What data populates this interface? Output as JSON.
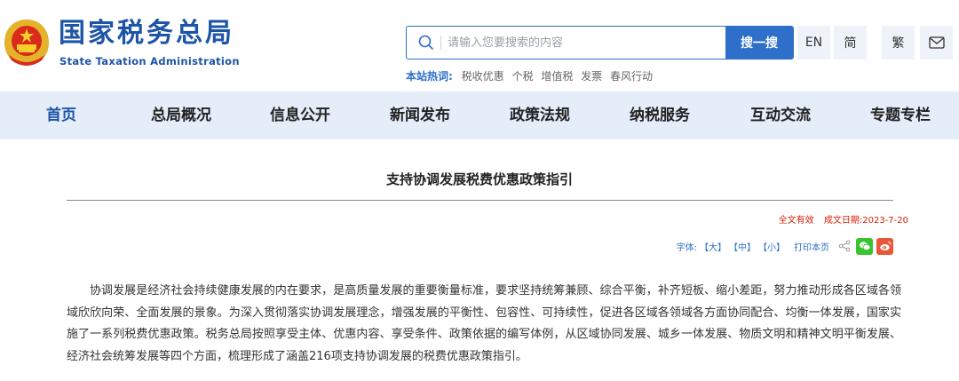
{
  "header": {
    "logo_cn": "国家税务总局",
    "logo_en": "State Taxation Administration"
  },
  "search": {
    "placeholder": "请输入您要搜索的内容",
    "button": "搜一搜"
  },
  "utility": {
    "en": "EN",
    "simplified": "简",
    "traditional": "繁",
    "mail_icon": "mail-icon"
  },
  "hot": {
    "label": "本站热词:",
    "items": [
      "税收优惠",
      "个税",
      "增值税",
      "发票",
      "春风行动"
    ]
  },
  "nav": {
    "items": [
      "首页",
      "总局概况",
      "信息公开",
      "新闻发布",
      "政策法规",
      "纳税服务",
      "互动交流",
      "专题专栏"
    ]
  },
  "article": {
    "title": "支持协调发展税费优惠政策指引",
    "validity": "全文有效",
    "date": "成文日期:2023-7-20",
    "font_label": "字体:",
    "font_large": "【大】",
    "font_medium": "【中】",
    "font_small": "【小】",
    "print": "打印本页",
    "paragraph": "协调发展是经济社会持续健康发展的内在要求，是高质量发展的重要衡量标准，要求坚持统筹兼顾、综合平衡，补齐短板、缩小差距，努力推动形成各区域各领域欣欣向荣、全面发展的景象。为深入贯彻落实协调发展理念，增强发展的平衡性、包容性、可持续性，促进各区域各领域各方面协同配合、均衡一体发展，国家实施了一系列税费优惠政策。税务总局按照享受主体、优惠内容、享受条件、政策依据的编写体例，从区域协同发展、城乡一体发展、物质文明和精神文明平衡发展、经济社会统筹发展等四个方面，梳理形成了涵盖216项支持协调发展的税费优惠政策指引。"
  },
  "colors": {
    "brand_blue": "#1d55a6",
    "search_blue": "#2d6fc9",
    "nav_bg": "#e4edf8",
    "alert_red": "#d81e06",
    "wechat_green": "#38c32f",
    "weibo_red": "#e8573a"
  }
}
